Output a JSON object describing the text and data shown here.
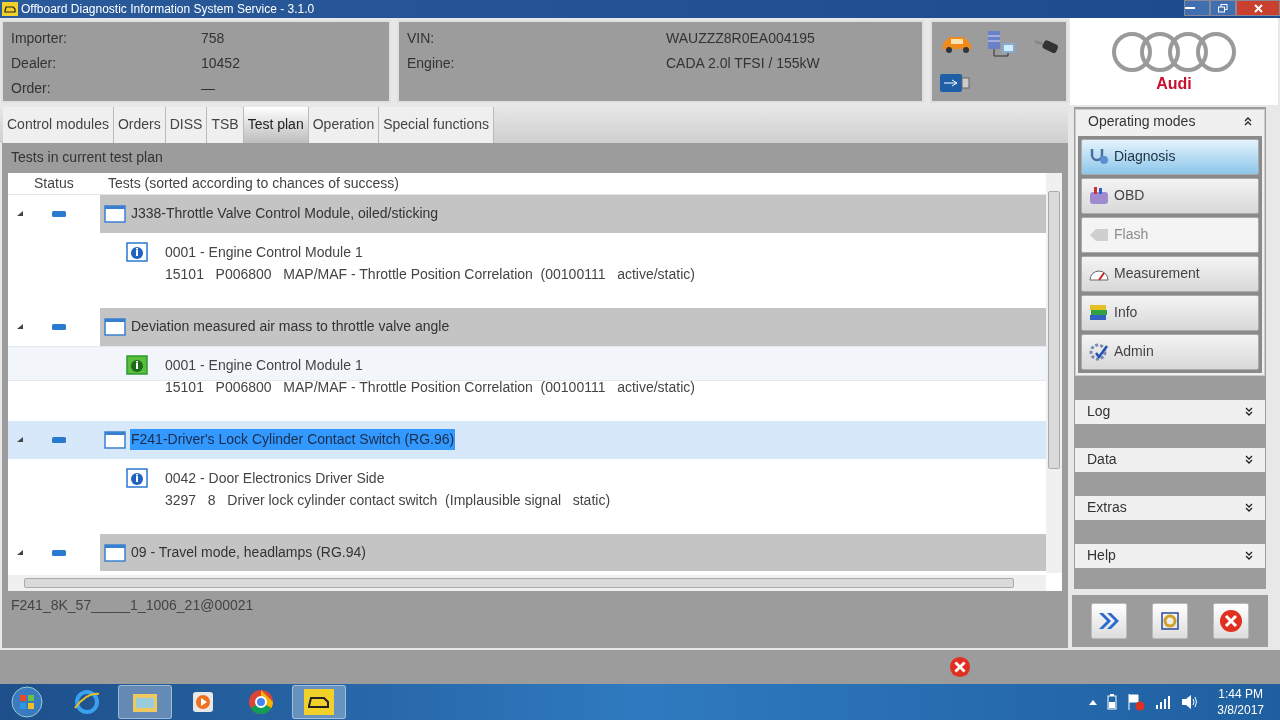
{
  "window": {
    "title": "Offboard Diagnostic Information System Service - 3.1.0"
  },
  "header": {
    "info": [
      {
        "label": "Importer:",
        "value": "758"
      },
      {
        "label": "Dealer:",
        "value": "10452"
      },
      {
        "label": "Order:",
        "value": "—"
      }
    ],
    "vehicle": [
      {
        "label": "VIN:",
        "value": "WAUZZZ8R0EA004195"
      },
      {
        "label": "Engine:",
        "value": "CADA 2.0l TFSI / 155kW"
      }
    ],
    "brand": "Audi"
  },
  "tabs": [
    {
      "label": "Control modules",
      "selected": false
    },
    {
      "label": "Orders",
      "selected": false
    },
    {
      "label": "DISS",
      "selected": false
    },
    {
      "label": "TSB",
      "selected": false
    },
    {
      "label": "Test plan",
      "selected": true
    },
    {
      "label": "Operation",
      "selected": false
    },
    {
      "label": "Special functions",
      "selected": false
    }
  ],
  "section_label": "Tests in current test plan",
  "table": {
    "columns": [
      "Status",
      "Tests (sorted according to chances of success)"
    ],
    "groups": [
      {
        "title": "J338-Throttle Valve Control Module, oiled/sticking",
        "selected": false,
        "details": [
          {
            "module": "0001 - Engine Control Module 1",
            "code": "15101   P006800   MAP/MAF - Throttle Position Correlation  (00100111   active/static)",
            "hovered": false
          }
        ]
      },
      {
        "title": "Deviation measured air mass to throttle valve angle",
        "selected": false,
        "details": [
          {
            "module": "0001 - Engine Control Module 1",
            "code": "15101   P006800   MAP/MAF - Throttle Position Correlation  (00100111   active/static)",
            "hovered": true
          }
        ]
      },
      {
        "title": "F241-Driver's Lock Cylinder Contact Switch (RG.96)",
        "selected": true,
        "details": [
          {
            "module": "0042 - Door Electronics Driver Side",
            "code": "3297   8   Driver lock cylinder contact switch  (Implausible signal   static)",
            "hovered": false
          }
        ]
      },
      {
        "title": "09 - Travel mode, headlamps (RG.94)",
        "selected": false
      }
    ]
  },
  "footer_text": "F241_8K_57_____1_1006_21@00021",
  "sidebar": {
    "title": "Operating modes",
    "expanded": true,
    "modes": [
      {
        "label": "Diagnosis",
        "kind": "stethoscope",
        "selected": true,
        "disabled": false
      },
      {
        "label": "OBD",
        "kind": "obd",
        "selected": false,
        "disabled": false
      },
      {
        "label": "Flash",
        "kind": "flash",
        "selected": false,
        "disabled": true
      },
      {
        "label": "Measurement",
        "kind": "gauge",
        "selected": false,
        "disabled": false
      },
      {
        "label": "Info",
        "kind": "books",
        "selected": false,
        "disabled": false
      },
      {
        "label": "Admin",
        "kind": "gear",
        "selected": false,
        "disabled": false
      }
    ],
    "sections": [
      {
        "label": "Log",
        "expanded": false
      },
      {
        "label": "Data",
        "expanded": false
      },
      {
        "label": "Extras",
        "expanded": false
      },
      {
        "label": "Help",
        "expanded": false
      }
    ]
  },
  "taskbar": {
    "time": "1:44 PM",
    "date": "3/8/2017"
  }
}
